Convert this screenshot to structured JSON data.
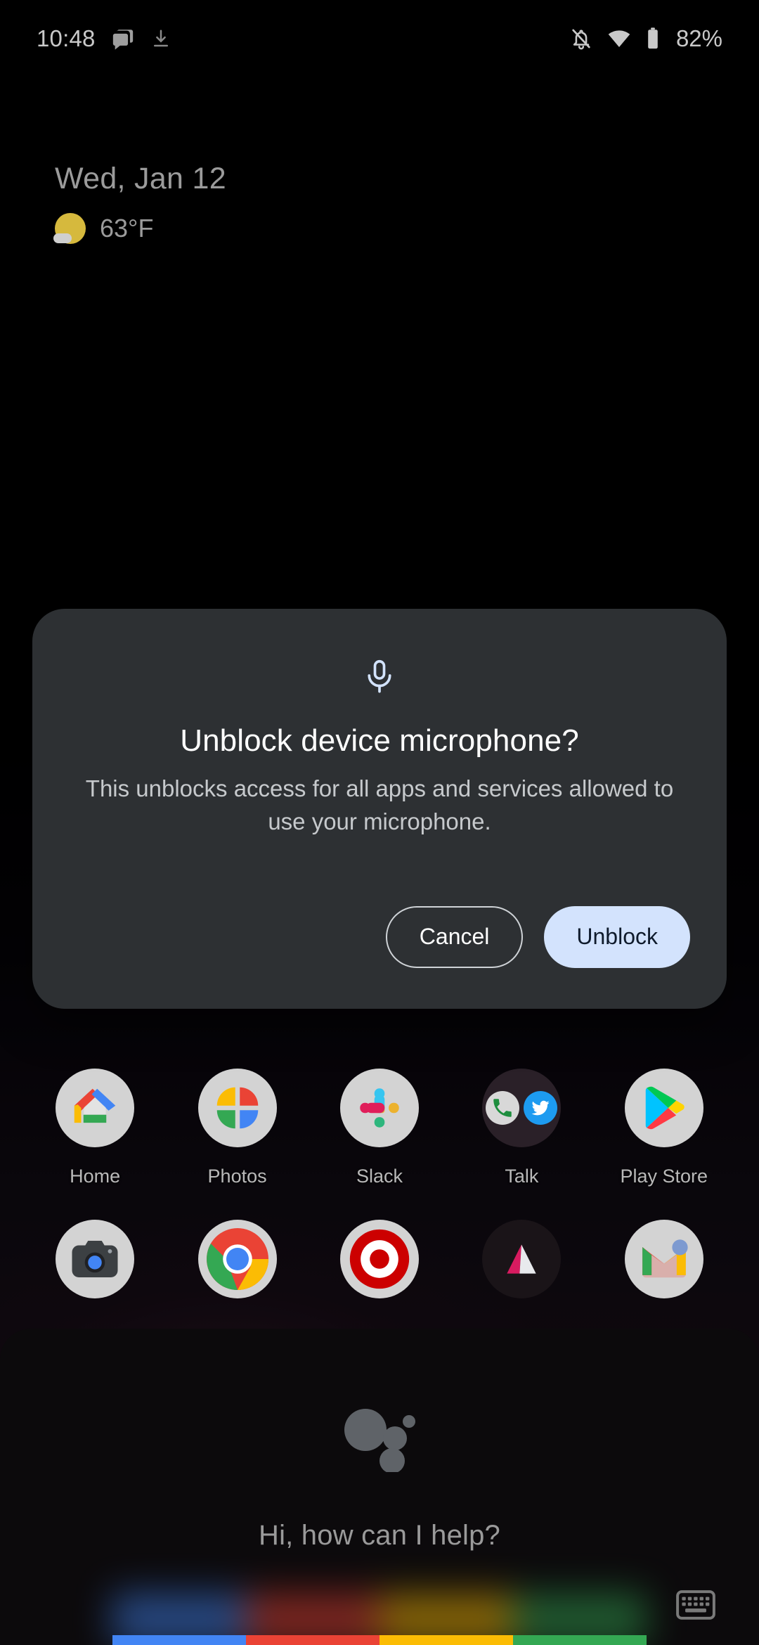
{
  "status_bar": {
    "time": "10:48",
    "icons_left": [
      "chat-bubbles-icon",
      "download-icon"
    ],
    "icons_right": [
      "notifications-off-icon",
      "wifi-icon",
      "battery-icon"
    ],
    "battery_percent": "82%"
  },
  "date_widget": {
    "date": "Wed, Jan 12",
    "weather_icon": "sun-cloud-icon",
    "temperature": "63°F"
  },
  "dialog": {
    "icon": "microphone-icon",
    "title": "Unblock device microphone?",
    "body": "This unblocks access for all apps and services allowed to use your microphone.",
    "cancel_label": "Cancel",
    "confirm_label": "Unblock",
    "background_color": "#2d3033",
    "confirm_bg_color": "#d3e3fd",
    "confirm_text_color": "#0f1b2c",
    "icon_color": "#d3e3fd"
  },
  "home_screen": {
    "rows": [
      {
        "apps": [
          {
            "label": "Home",
            "icon": "google-home-icon"
          },
          {
            "label": "Photos",
            "icon": "google-photos-icon"
          },
          {
            "label": "Slack",
            "icon": "slack-icon"
          },
          {
            "label": "Talk",
            "icon": "folder-phone-twitter-icon"
          },
          {
            "label": "Play Store",
            "icon": "google-play-store-icon"
          }
        ]
      },
      {
        "apps": [
          {
            "label": "",
            "icon": "camera-icon"
          },
          {
            "label": "",
            "icon": "chrome-icon"
          },
          {
            "label": "",
            "icon": "target-icon"
          },
          {
            "label": "",
            "icon": "play-movies-icon"
          },
          {
            "label": "",
            "icon": "gmail-icon"
          }
        ]
      }
    ]
  },
  "assistant": {
    "logo": "google-assistant-dots-icon",
    "prompt": "Hi, how can I help?",
    "keyboard_icon": "keyboard-icon",
    "bar_colors": [
      "#4285f4",
      "#ea4335",
      "#fbbc04",
      "#34a853"
    ]
  }
}
